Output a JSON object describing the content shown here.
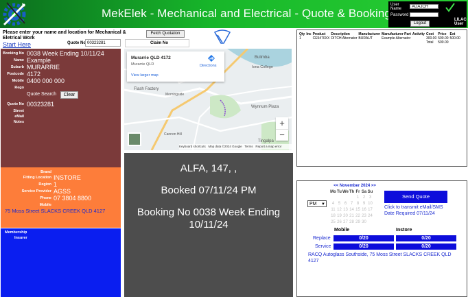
{
  "header": {
    "title": "MekElek - Mechanical and Electrical - Quote & Booking",
    "login": {
      "user_name_label": "User Name",
      "user_name_value": "AUAJCH",
      "password_label": "Password",
      "logout_label": "Logout",
      "user_role": "LILAC User"
    }
  },
  "top": {
    "prompt": "Please enter your name and location for Mechanical & Eletrical Work",
    "start_here": "Start Here",
    "fetch_button": "Fetch Quotation",
    "quote_no_label": "Quote No",
    "quote_no_value": "00323281",
    "claim_no_label": "Claim No"
  },
  "customer": {
    "booking_label": "Booking No",
    "booking_value": "0038 Week Ending 10/11/24",
    "name_label": "Name",
    "name_value": "Example",
    "suburb_label": "Suburb",
    "suburb_value": "MURARRIE",
    "postcode_label": "Postcode",
    "postcode_value": "4172",
    "mobile_label": "Mobile",
    "mobile_value": "0400 000 000",
    "rego_label": "Rego",
    "quote_search_label": "Quote Search",
    "clear_button": "Clear",
    "quote_no_label": "Quote No",
    "quote_no_value": "00323281",
    "street_label": "Street",
    "email_label": "eMail",
    "notes_label": "Notes"
  },
  "fitting": {
    "brand_label": "Brand",
    "location_label": "Fitting Location",
    "location_value": "INSTORE",
    "region_label": "Region",
    "region_value": "1",
    "provider_label": "Service Provider",
    "provider_value": "AGSS",
    "phone_label": "Phone",
    "phone_value": "07 3804 8800",
    "mobile_label": "Mobile",
    "address": "75 Moss Street SLACKS CREEK QLD 4127"
  },
  "membership": {
    "membership_label": "Membership",
    "insurer_label": "Insurer"
  },
  "map": {
    "card_title": "Murarrie QLD 4172",
    "card_sub": "Murarrie QLD",
    "directions": "Directions",
    "larger_map": "View larger map",
    "places": [
      "Iona College",
      "Bulimba",
      "Flash Factory",
      "Wynnum Plaza",
      "Tingalpa",
      "Cannon Hill",
      "Morningside"
    ],
    "footer": [
      "Keyboard shortcuts",
      "Map data ©2024 Google",
      "Terms",
      "Report a map error"
    ],
    "zoom_in": "+",
    "zoom_out": "−"
  },
  "booking_display": {
    "line1": "ALFA, 147, ,",
    "line2": "Booked 07/11/24 PM",
    "line3": "Booking No 0038 Week Ending 10/11/24"
  },
  "quote_table": {
    "headers": [
      "Qty",
      "Inc",
      "Product",
      "Description",
      "Manufacturer",
      "Manufacturer Part",
      "Activity",
      "Cost",
      "Price",
      "Ext"
    ],
    "rows": [
      [
        "1",
        "",
        "CE5470XX",
        "DITCH Alternator",
        "BURAUT",
        "Example Alternator",
        "",
        "300.00",
        "500.00",
        "500.00"
      ]
    ],
    "total_label": "Total",
    "total_value": "500.00"
  },
  "calendar": {
    "prev": "<<",
    "month": "November 2024",
    "next": ">>",
    "days": [
      "Mo",
      "Tu",
      "We",
      "Th",
      "Fr",
      "Sa",
      "Su"
    ],
    "weeks": [
      [
        "",
        "",
        "",
        "",
        "1",
        "2",
        "3"
      ],
      [
        "4",
        "5",
        "6",
        "7",
        "8",
        "9",
        "10"
      ],
      [
        "11",
        "12",
        "13",
        "14",
        "15",
        "16",
        "17"
      ],
      [
        "18",
        "19",
        "20",
        "21",
        "22",
        "23",
        "24"
      ],
      [
        "25",
        "26",
        "27",
        "28",
        "29",
        "30",
        ""
      ]
    ],
    "ampm": "PM",
    "send_quote": "Send Quote",
    "transmit_text": "Click to transmit eMail/SMS",
    "date_required": "Date Required 07/11/24",
    "mobile_label": "Mobile",
    "instore_label": "Instore",
    "replace_label": "Replace",
    "service_label": "Service",
    "replace_mobile": "0/20",
    "replace_instore": "0/20",
    "service_mobile": "0/20",
    "service_instore": "0/20",
    "provider_address": "RACQ Autoglass Southside, 75 Moss Street SLACKS CREEK QLD 4127"
  },
  "colors": {
    "header_green": "#17b62a",
    "customer_panel": "#7b3a3a",
    "fitting_panel": "#fd7d3a",
    "membership_panel": "#0a1ef0",
    "booking_panel": "#4d4d4d",
    "button_blue": "#0d0ddb"
  }
}
